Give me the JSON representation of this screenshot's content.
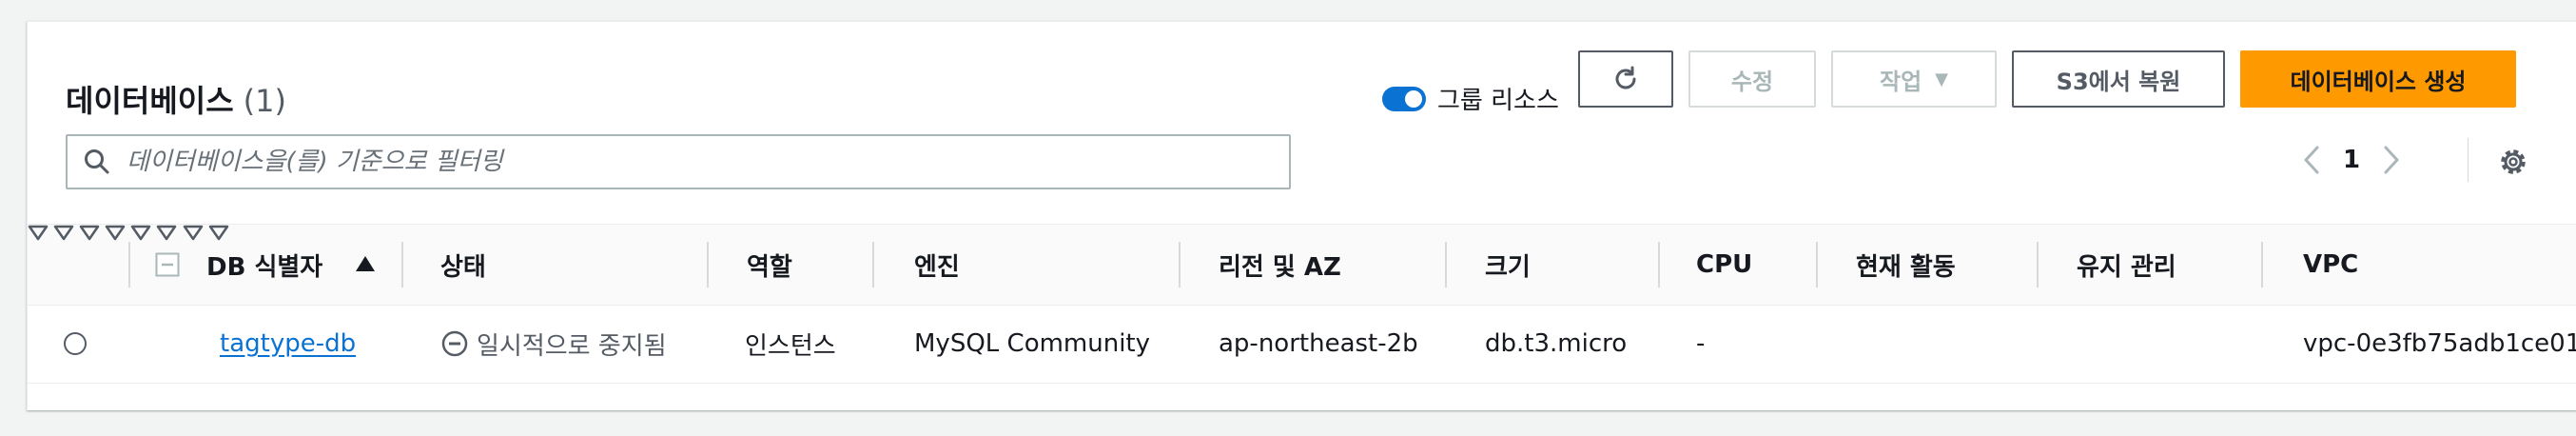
{
  "header": {
    "title": "데이터베이스",
    "count": "(1)",
    "group_toggle_label": "그룹 리소스",
    "group_toggle_on": true,
    "buttons": {
      "modify": "수정",
      "actions": "작업",
      "restore_s3": "S3에서 복원",
      "create": "데이터베이스 생성"
    }
  },
  "search": {
    "placeholder": "데이터베이스을(를) 기준으로 필터링"
  },
  "pagination": {
    "current_page": "1"
  },
  "table": {
    "columns": {
      "db_id": "DB 식별자",
      "status": "상태",
      "role": "역할",
      "engine": "엔진",
      "region": "리전 및 AZ",
      "size": "크기",
      "cpu": "CPU",
      "activity": "현재 활동",
      "maintenance": "유지 관리",
      "vpc": "VPC"
    },
    "rows": [
      {
        "db_id": "tagtype-db",
        "status": "일시적으로 중지됨",
        "role": "인스턴스",
        "engine": "MySQL Community",
        "region": "ap-northeast-2b",
        "size": "db.t3.micro",
        "cpu": "-",
        "activity": "",
        "maintenance": "",
        "vpc": "vpc-0e3fb75adb1ce01"
      }
    ]
  },
  "colors": {
    "primary": "#ff9900",
    "link": "#0972d3",
    "toggle": "#0972d3"
  }
}
